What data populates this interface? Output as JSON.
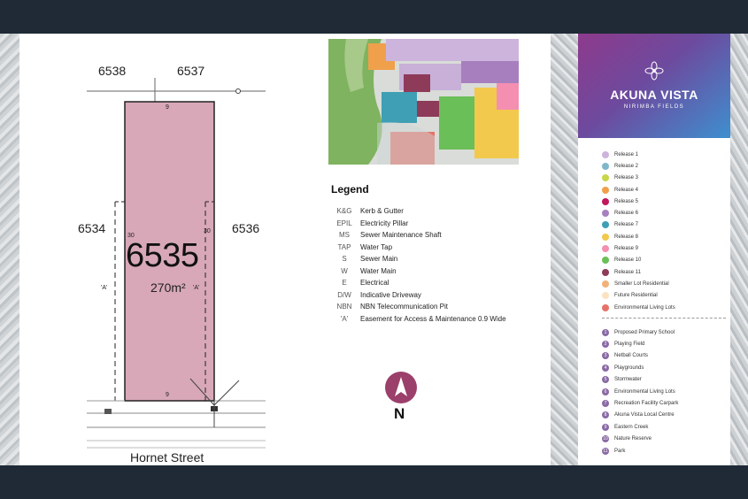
{
  "plan": {
    "neighbor_top_left": "6538",
    "neighbor_top_right": "6537",
    "neighbor_left": "6534",
    "neighbor_right": "6536",
    "lot_number": "6535",
    "lot_area": "270m²",
    "frontage_top": "9",
    "frontage_bottom": "9",
    "depth_left": "30",
    "depth_right": "30",
    "easement_left": "'A'",
    "easement_right": "'A'",
    "street_name": "Hornet Street"
  },
  "legend": {
    "title": "Legend",
    "items": [
      {
        "symbol": "K&G",
        "label": "Kerb & Gutter"
      },
      {
        "symbol": "EPIL",
        "label": "Electricity Pillar"
      },
      {
        "symbol": "MS",
        "label": "Sewer Maintenance Shaft"
      },
      {
        "symbol": "TAP",
        "label": "Water Tap"
      },
      {
        "symbol": "S",
        "label": "Sewer Main"
      },
      {
        "symbol": "W",
        "label": "Water Main"
      },
      {
        "symbol": "E",
        "label": "Electrical"
      },
      {
        "symbol": "D/W",
        "label": "Indicative Driveway"
      },
      {
        "symbol": "NBN",
        "label": "NBN Telecommunication Pit"
      },
      {
        "symbol": "'A'",
        "label": "Easement for Access & Maintenance 0.9 Wide"
      }
    ]
  },
  "north": {
    "label": "N"
  },
  "brand": {
    "name": "AKUNA VISTA",
    "subtitle": "NIRIMBA FIELDS"
  },
  "releases": [
    {
      "label": "Release 1",
      "color": "#cdb4dc"
    },
    {
      "label": "Release 2",
      "color": "#7fb7c9"
    },
    {
      "label": "Release 3",
      "color": "#c8d64a"
    },
    {
      "label": "Release 4",
      "color": "#f0a04b"
    },
    {
      "label": "Release 5",
      "color": "#c2185b"
    },
    {
      "label": "Release 6",
      "color": "#a77fbf"
    },
    {
      "label": "Release 7",
      "color": "#3f9fb5"
    },
    {
      "label": "Release 8",
      "color": "#f2c94c"
    },
    {
      "label": "Release 9",
      "color": "#f48fb1"
    },
    {
      "label": "Release 10",
      "color": "#6bbf59"
    },
    {
      "label": "Release 11",
      "color": "#8e3b5a"
    },
    {
      "label": "Smaller Lot Residential",
      "color": "#f0b27a"
    },
    {
      "label": "Future Residential",
      "color": "#fbe3c2"
    },
    {
      "label": "Environmental Living Lots",
      "color": "#e57368"
    }
  ],
  "amenities": [
    {
      "num": "1",
      "label": "Proposed Primary School"
    },
    {
      "num": "2",
      "label": "Playing Field"
    },
    {
      "num": "3",
      "label": "Netball Courts"
    },
    {
      "num": "4",
      "label": "Playgrounds"
    },
    {
      "num": "5",
      "label": "Stormwater"
    },
    {
      "num": "6",
      "label": "Environmental Living Lots"
    },
    {
      "num": "7",
      "label": "Recreation Facility Carpark"
    },
    {
      "num": "8",
      "label": "Akuna Vista Local Centre"
    },
    {
      "num": "9",
      "label": "Eastern Creek"
    },
    {
      "num": "10",
      "label": "Nature Reserve"
    },
    {
      "num": "11",
      "label": "Park"
    }
  ]
}
